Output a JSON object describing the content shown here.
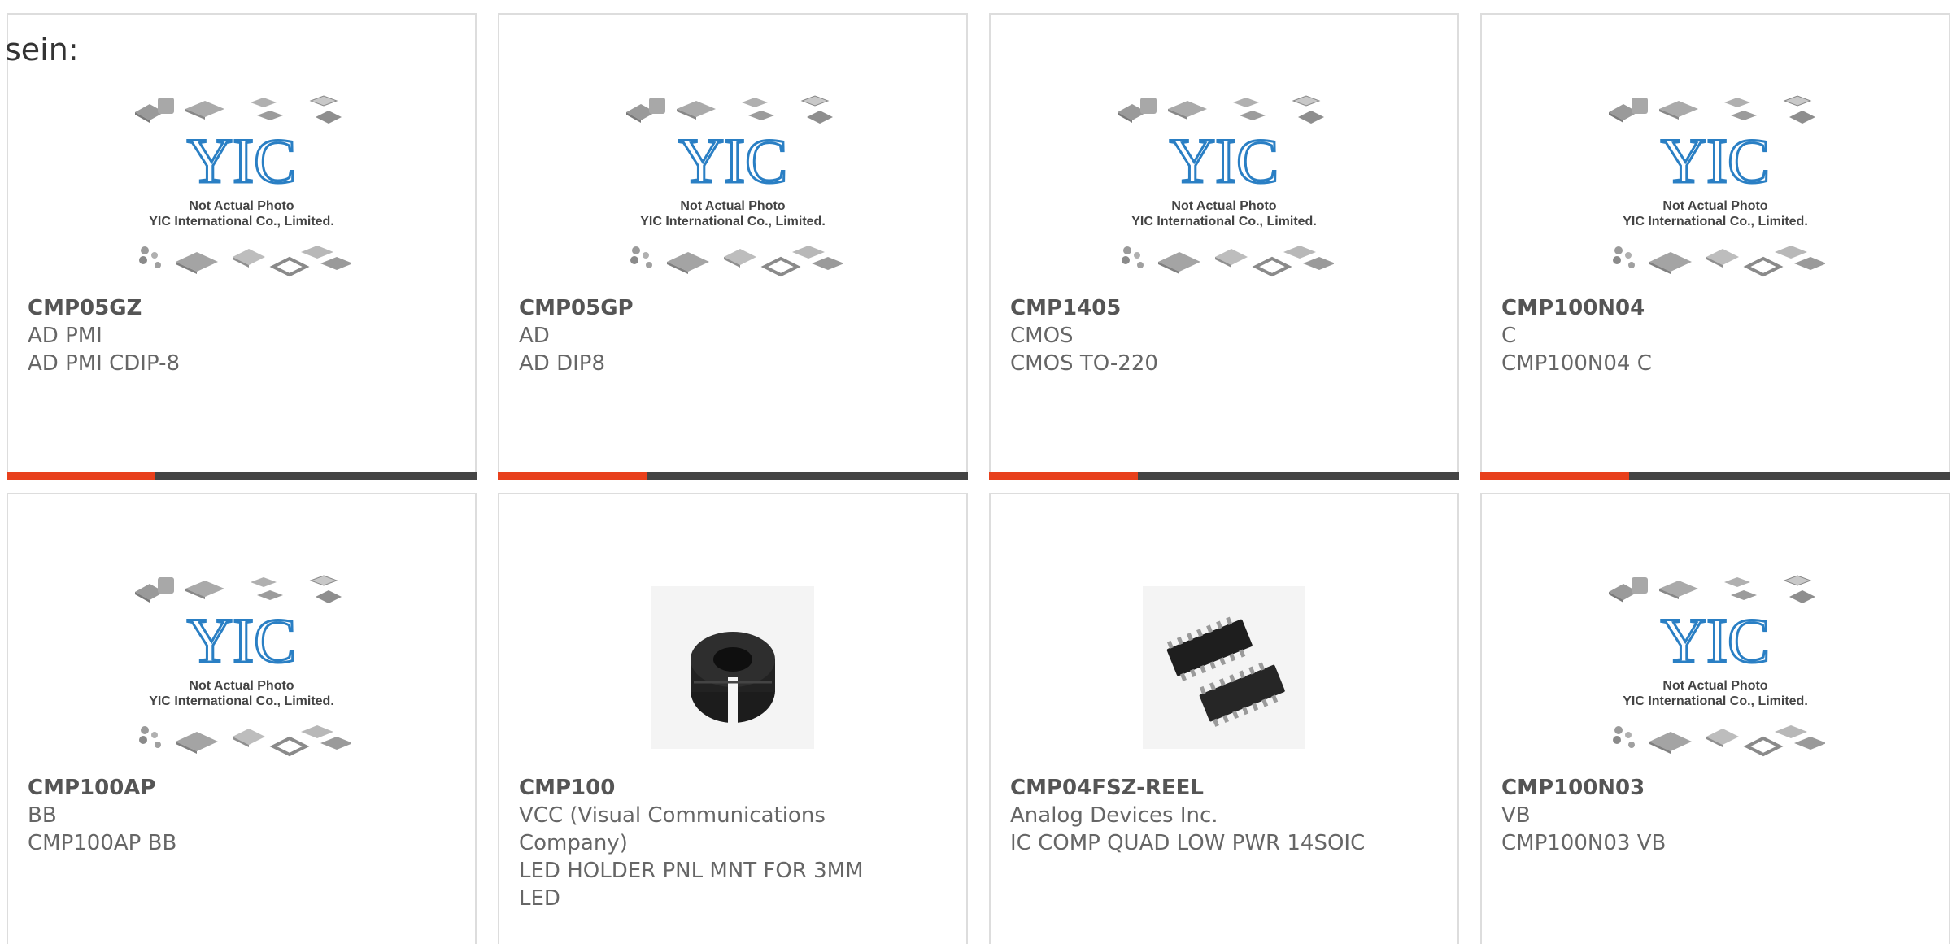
{
  "intro_text": "sein:",
  "placeholder": {
    "logo_text": "YIC",
    "caption1": "Not Actual Photo",
    "caption2": "YIC International Co., Limited."
  },
  "products": [
    {
      "part": "CMP05GZ",
      "brand": "AD PMI",
      "desc": "AD PMI CDIP-8",
      "image": "placeholder"
    },
    {
      "part": "CMP05GP",
      "brand": "AD",
      "desc": "AD DIP8",
      "image": "placeholder"
    },
    {
      "part": "CMP1405",
      "brand": "CMOS",
      "desc": "CMOS TO-220",
      "image": "placeholder"
    },
    {
      "part": "CMP100N04",
      "brand": "C",
      "desc": "CMP100N04 C",
      "image": "placeholder"
    },
    {
      "part": "CMP100AP",
      "brand": "BB",
      "desc": "CMP100AP BB",
      "image": "placeholder"
    },
    {
      "part": "CMP100",
      "brand": "VCC (Visual Communications Company)",
      "desc": "LED HOLDER PNL MNT FOR 3MM LED",
      "image": "led-holder-photo"
    },
    {
      "part": "CMP04FSZ-REEL",
      "brand": "Analog Devices Inc.",
      "desc": "IC COMP QUAD LOW PWR 14SOIC",
      "image": "soic-chip-photo"
    },
    {
      "part": "CMP100N03",
      "brand": "VB",
      "desc": "CMP100N03 VB",
      "image": "placeholder"
    }
  ],
  "colors": {
    "accent": "#e8401c",
    "bar": "#444444",
    "border": "#dddddd",
    "logo_blue": "#2a7fc4"
  }
}
